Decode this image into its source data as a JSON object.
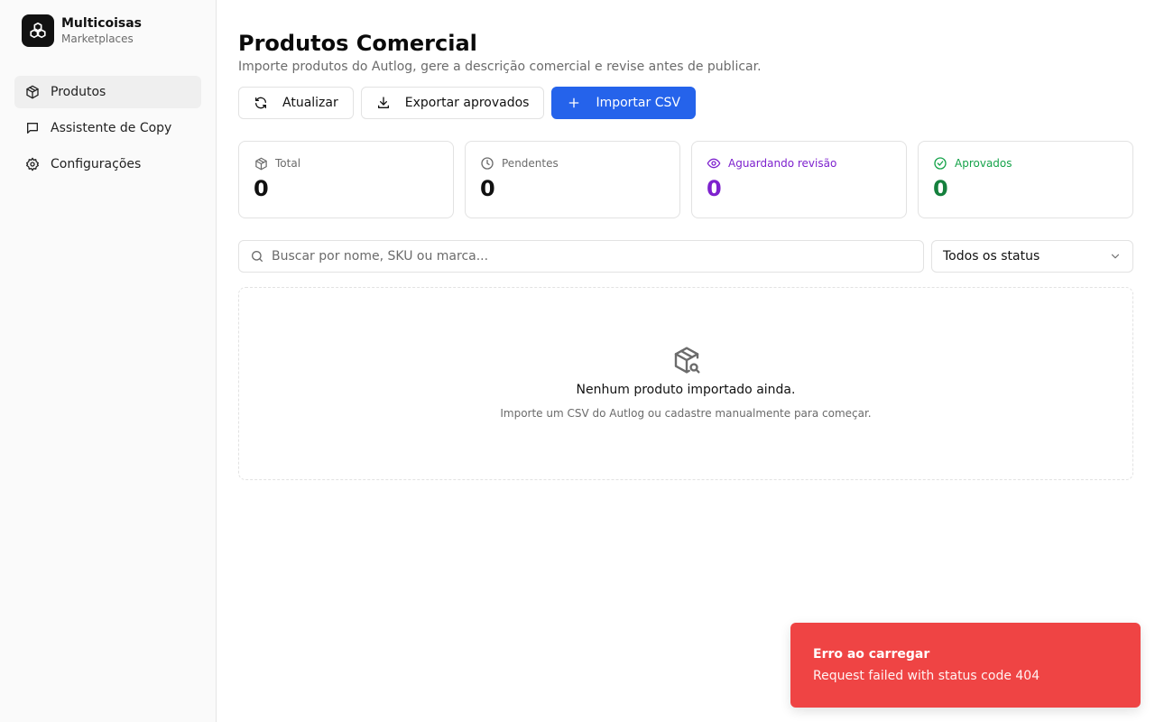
{
  "brand": {
    "name": "Multicoisas",
    "subtitle": "Marketplaces",
    "logo_icon": "boxes-icon"
  },
  "sidebar": {
    "items": [
      {
        "label": "Produtos",
        "icon": "package-icon",
        "active": true
      },
      {
        "label": "Assistente de Copy",
        "icon": "message-square-icon",
        "active": false
      },
      {
        "label": "Configurações",
        "icon": "gear-icon",
        "active": false
      }
    ]
  },
  "header": {
    "title": "Produtos Comercial",
    "subtitle": "Importe produtos do Autlog, gere a descrição comercial e revise antes de publicar."
  },
  "actions": {
    "refresh_label": "Atualizar",
    "export_label": "Exportar aprovados",
    "import_label": "Importar CSV"
  },
  "stats": [
    {
      "label": "Total",
      "value": "0",
      "icon": "package-icon",
      "color": "#111111",
      "label_color": "#6b6b6b"
    },
    {
      "label": "Pendentes",
      "value": "0",
      "icon": "clock-icon",
      "color": "#111111",
      "label_color": "#6b6b6b"
    },
    {
      "label": "Aguardando revisão",
      "value": "0",
      "icon": "eye-icon",
      "color": "#7e22ce",
      "label_color": "#7e22ce"
    },
    {
      "label": "Aprovados",
      "value": "0",
      "icon": "check-circle-icon",
      "color": "#15803d",
      "label_color": "#16a34a"
    }
  ],
  "filters": {
    "search_placeholder": "Buscar por nome, SKU ou marca...",
    "status_selected": "Todos os status"
  },
  "empty_state": {
    "title": "Nenhum produto importado ainda.",
    "description": "Importe um CSV do Autlog ou cadastre manualmente para começar."
  },
  "toast": {
    "title": "Erro ao carregar",
    "message": "Request failed with status code 404",
    "color": "#ef4444"
  },
  "colors": {
    "primary": "#2563eb",
    "review": "#7e22ce",
    "approved": "#15803d",
    "error": "#ef4444"
  }
}
